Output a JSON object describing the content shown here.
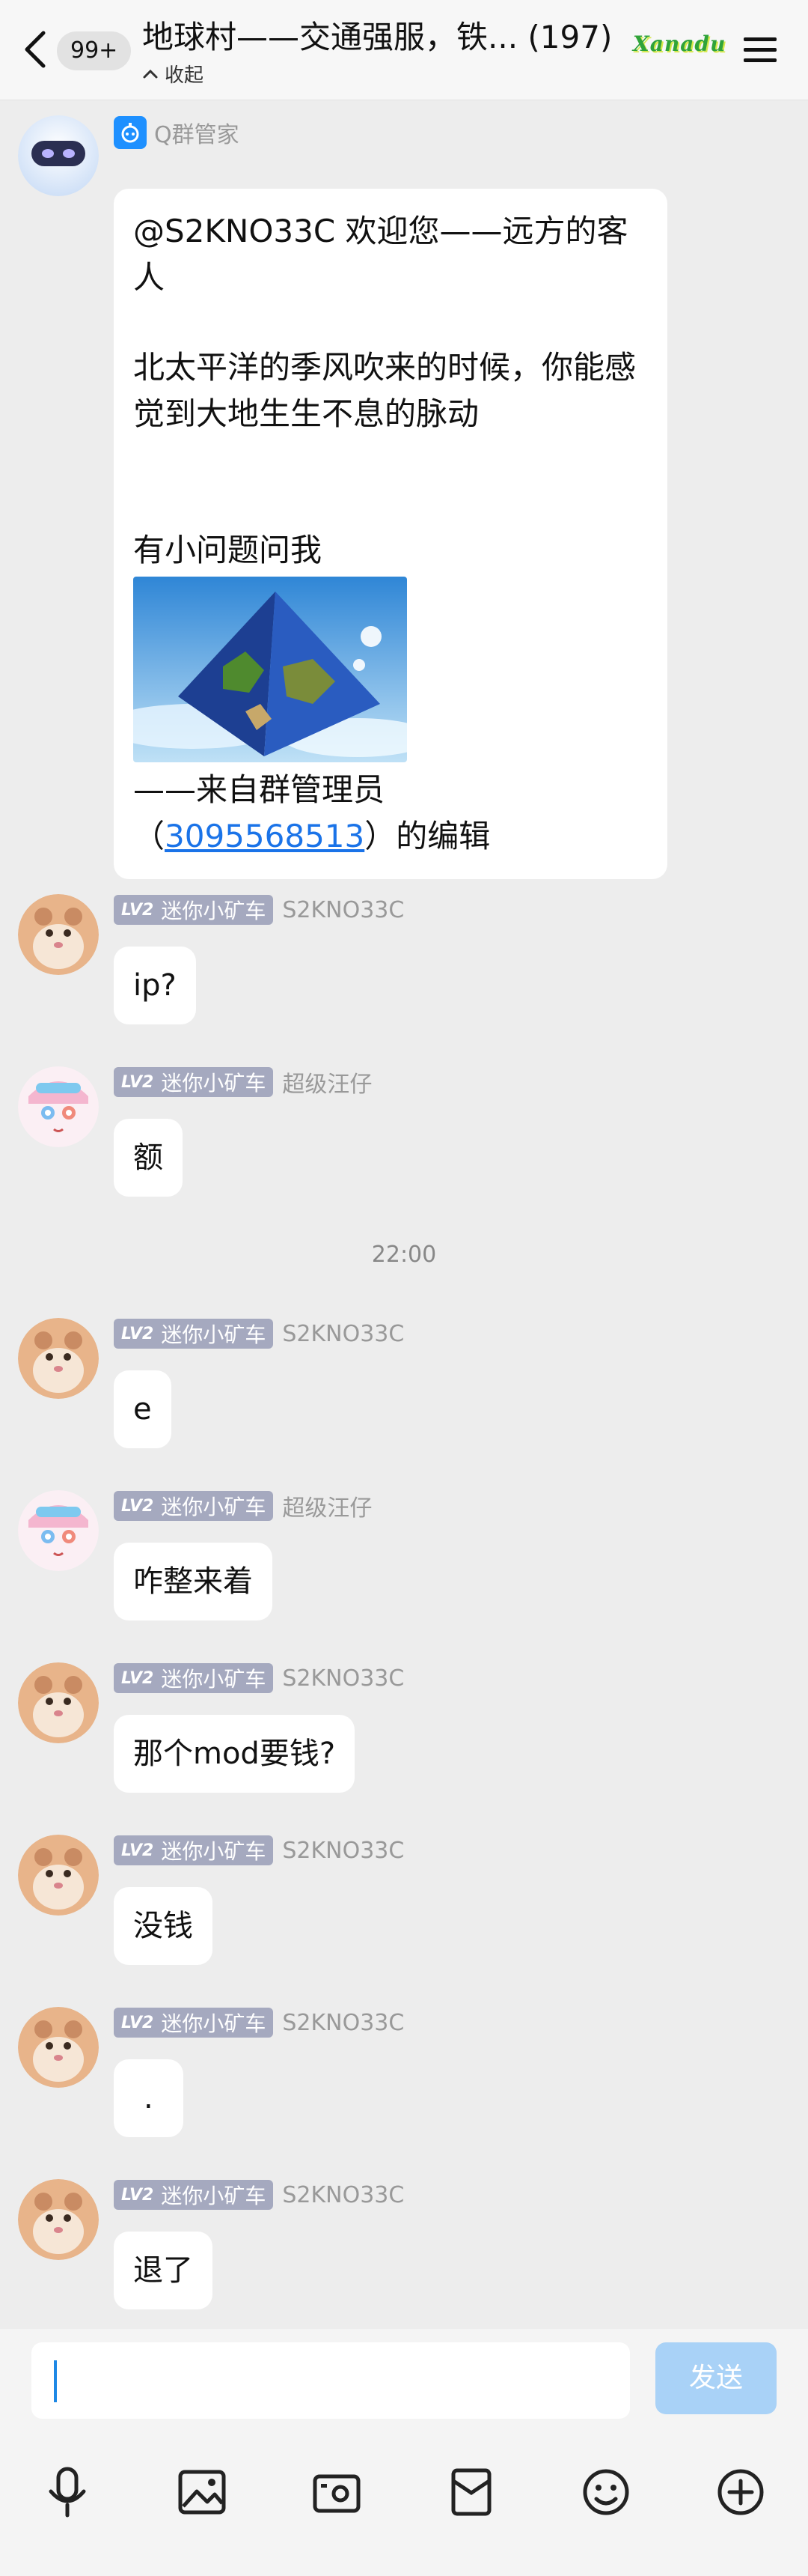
{
  "header": {
    "unread": "99+",
    "title": "地球村——交通强服，铁... (197)",
    "collapse_label": "收起",
    "logo_text": "Xanadu"
  },
  "messages": [
    {
      "sender": "Q群管家",
      "welcome_line1": "@S2KNO33C 欢迎您——远方的客人",
      "welcome_line2": "北太平洋的季风吹来的时候，你能感觉到大地生生不息的脉动",
      "welcome_line3": "有小问题问我",
      "welcome_sig": "——来自群管理员",
      "welcome_edit_prefix": "（",
      "welcome_edit_link": "3095568513",
      "welcome_edit_suffix": "）的编辑"
    },
    {
      "lv": "LV2",
      "title": "迷你小矿车",
      "sender": "S2KNO33C",
      "text": "ip?"
    },
    {
      "lv": "LV2",
      "title": "迷你小矿车",
      "sender": "超级汪仔",
      "text": "额"
    },
    {
      "lv": "LV2",
      "title": "迷你小矿车",
      "sender": "S2KNO33C",
      "text": "e"
    },
    {
      "lv": "LV2",
      "title": "迷你小矿车",
      "sender": "超级汪仔",
      "text": "咋整来着"
    },
    {
      "lv": "LV2",
      "title": "迷你小矿车",
      "sender": "S2KNO33C",
      "text": "那个mod要钱?"
    },
    {
      "lv": "LV2",
      "title": "迷你小矿车",
      "sender": "S2KNO33C",
      "text": "没钱"
    },
    {
      "lv": "LV2",
      "title": "迷你小矿车",
      "sender": "S2KNO33C",
      "text": "."
    },
    {
      "lv": "LV2",
      "title": "迷你小矿车",
      "sender": "S2KNO33C",
      "text": "退了"
    }
  ],
  "time_separator": "22:00",
  "input": {
    "value": "",
    "send_label": "发送"
  },
  "toolbar": {
    "icons": [
      "microphone-icon",
      "image-icon",
      "camera-icon",
      "red-packet-icon",
      "emoji-icon",
      "plus-icon"
    ]
  },
  "colors": {
    "send_button": "#a9d2f7",
    "link": "#1a73e8",
    "badge": "#a5a9bf",
    "bot_icon": "#1e90ff"
  }
}
